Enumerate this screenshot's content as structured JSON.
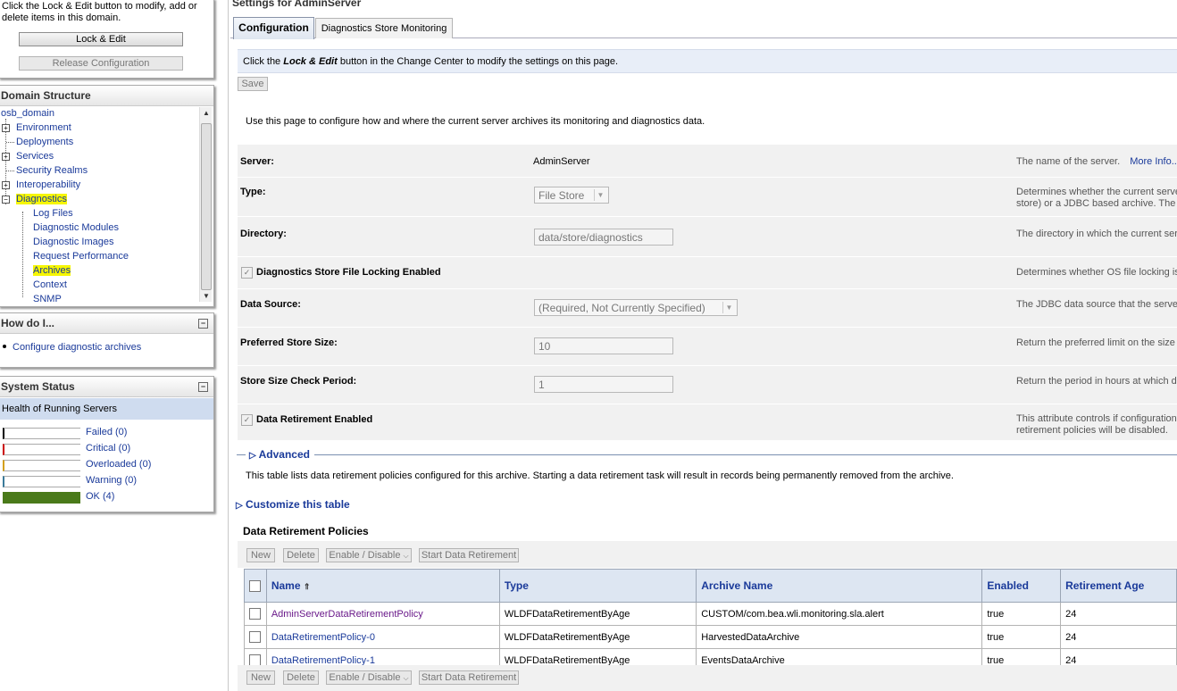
{
  "change_center": {
    "instruction": "Click the Lock & Edit button to modify, add or delete items in this domain.",
    "lock_edit_label": "Lock & Edit",
    "release_label": "Release Configuration"
  },
  "domain_structure": {
    "title": "Domain Structure",
    "root": "osb_domain",
    "items": [
      "Environment",
      "Deployments",
      "Services",
      "Security Realms",
      "Interoperability",
      "Diagnostics"
    ],
    "diagnostics_children": [
      "Log Files",
      "Diagnostic Modules",
      "Diagnostic Images",
      "Request Performance",
      "Archives",
      "Context",
      "SNMP"
    ]
  },
  "how_do_i": {
    "title": "How do I...",
    "links": [
      "Configure diagnostic archives"
    ]
  },
  "system_status": {
    "title": "System Status",
    "subtitle": "Health of Running Servers",
    "rows": [
      {
        "label": "Failed (0)",
        "color": "#000000",
        "fill": 0
      },
      {
        "label": "Critical (0)",
        "color": "#cc0000",
        "fill": 0
      },
      {
        "label": "Overloaded (0)",
        "color": "#d4a017",
        "fill": 0
      },
      {
        "label": "Warning (0)",
        "color": "#3a7a9a",
        "fill": 0
      },
      {
        "label": "OK (4)",
        "color": "#4a7a1a",
        "fill": 1
      }
    ]
  },
  "main": {
    "page_title": "Settings for AdminServer",
    "tabs": [
      "Configuration",
      "Diagnostics Store Monitoring"
    ],
    "active_tab": "Configuration",
    "lock_msg_pre": "Click the",
    "lock_msg_emph": "Lock & Edit",
    "lock_msg_post": "button in the Change Center to modify the settings on this page.",
    "save_label": "Save",
    "intro": "Use this page to configure how and where the current server archives its monitoring and diagnostics data.",
    "fields": {
      "server": {
        "label": "Server:",
        "value": "AdminServer",
        "desc": "The name of the server.",
        "more": "More Info..."
      },
      "type": {
        "label": "Type:",
        "value": "File Store",
        "desc1": "Determines whether the current serve",
        "desc2": "store) or a JDBC based archive. The c"
      },
      "directory": {
        "label": "Directory:",
        "value": "data/store/diagnostics",
        "desc": "The directory in which the current ser"
      },
      "locking": {
        "label": "Diagnostics Store File Locking Enabled",
        "desc": "Determines whether OS file locking is"
      },
      "datasource": {
        "label": "Data Source:",
        "value": "(Required, Not Currently Specified)",
        "desc": "The JDBC data source that the server"
      },
      "pref_size": {
        "label": "Preferred Store Size:",
        "value": "10",
        "desc": "Return the preferred limit on the size"
      },
      "check_period": {
        "label": "Store Size Check Period:",
        "value": "1",
        "desc": "Return the period in hours at which di"
      },
      "retirement": {
        "label": "Data Retirement Enabled",
        "desc1": "This attribute controls if configuration",
        "desc2": "retirement policies will be disabled."
      }
    },
    "advanced_label": "Advanced",
    "table_intro": "This table lists data retirement policies configured for this archive. Starting a data retirement task will result in records being permanently removed from the archive.",
    "customize_label": "Customize this table",
    "table_title": "Data Retirement Policies",
    "table_buttons": [
      "New",
      "Delete",
      "Enable / Disable",
      "Start Data Retirement"
    ],
    "columns": [
      "Name",
      "Type",
      "Archive Name",
      "Enabled",
      "Retirement Age"
    ],
    "rows": [
      [
        "AdminServerDataRetirementPolicy",
        "WLDFDataRetirementByAge",
        "CUSTOM/com.bea.wli.monitoring.sla.alert",
        "true",
        "24"
      ],
      [
        "DataRetirementPolicy-0",
        "WLDFDataRetirementByAge",
        "HarvestedDataArchive",
        "true",
        "24"
      ],
      [
        "DataRetirementPolicy-1",
        "WLDFDataRetirementByAge",
        "EventsDataArchive",
        "true",
        "24"
      ]
    ]
  },
  "colors": {
    "link": "#1a3a9a",
    "highlight": "#f6f600",
    "banner": "#e8eef8",
    "table_header": "#dde6f2"
  }
}
